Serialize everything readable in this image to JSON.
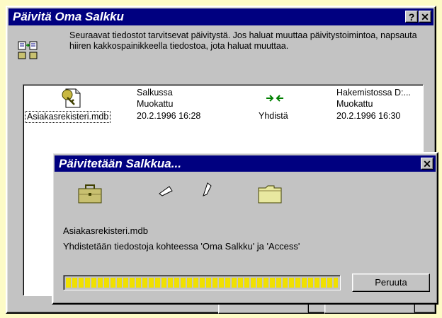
{
  "main_window": {
    "title": "Päivitä Oma Salkku",
    "help_button": "?",
    "close_button": "✕",
    "intro": "Seuraavat tiedostot tarvitsevat päivitystä. Jos haluat muuttaa päivitystoimintoa, napsauta hiiren kakkospainikkeella tiedostoa, jota haluat muuttaa.",
    "file": {
      "name": "Asiakasrekisteri.mdb",
      "left_location": "Salkussa",
      "left_status": "Muokattu",
      "left_date": "20.2.1996 16:28",
      "action": "Yhdistä",
      "right_location": "Hakemistossa D:...",
      "right_status": "Muokattu",
      "right_date": "20.2.1996 16:30"
    }
  },
  "progress_dialog": {
    "title": "Päivitetään Salkkua...",
    "close_button": "✕",
    "filename": "Asiakasrekisteri.mdb",
    "status": "Yhdistetään tiedostoja kohteessa 'Oma Salkku' ja 'Access'",
    "progress": 1.0,
    "cancel_label": "Peruuta"
  },
  "colors": {
    "title_bar": "#000080",
    "progress_fill": "#f0e000",
    "window_face": "#c3c3c3",
    "page_background": "#fdfbc6"
  },
  "icons": {
    "intro": "briefcase-update-icon",
    "file": "access-database-icon",
    "action": "merge-arrows-icon",
    "source": "briefcase-icon",
    "flying_paper": "flying-document-icon",
    "target": "folder-icon"
  }
}
